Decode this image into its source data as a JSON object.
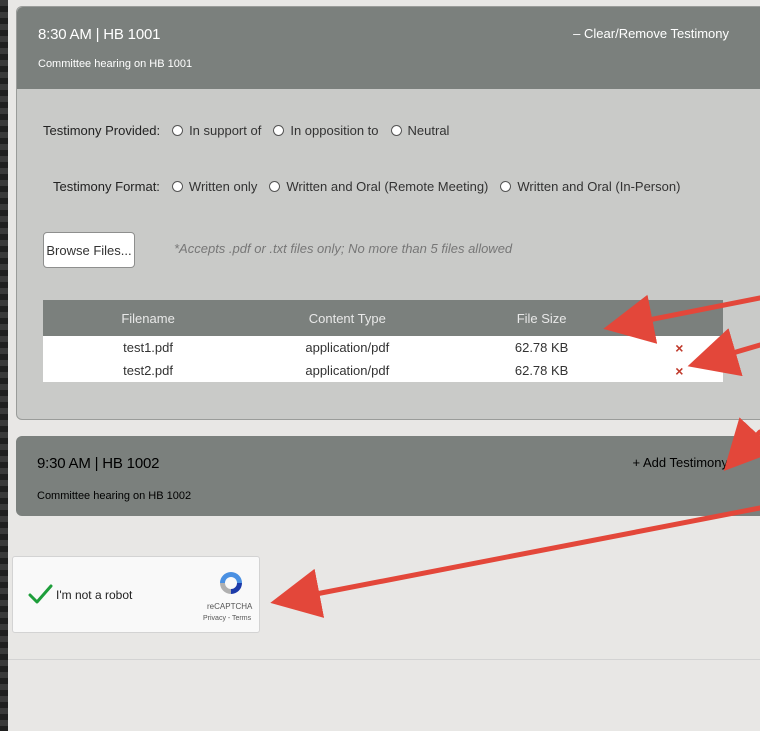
{
  "hearing1": {
    "time_label": "8:30 AM  |  HB 1001",
    "subtitle": "Committee hearing on HB 1001",
    "action": "– Clear/Remove Testimony"
  },
  "testimony_provided": {
    "label": "Testimony Provided:",
    "options": [
      "In support of",
      "In opposition to",
      "Neutral"
    ]
  },
  "testimony_format": {
    "label": "Testimony Format:",
    "options": [
      "Written only",
      "Written and Oral (Remote Meeting)",
      "Written and Oral (In-Person)"
    ]
  },
  "upload": {
    "browse_label": "Browse Files...",
    "hint": "*Accepts .pdf or .txt files only; No more than 5 files allowed"
  },
  "files_table": {
    "headers": [
      "Filename",
      "Content Type",
      "File Size"
    ],
    "rows": [
      {
        "filename": "test1.pdf",
        "content_type": "application/pdf",
        "size": "62.78 KB",
        "remove": "×"
      },
      {
        "filename": "test2.pdf",
        "content_type": "application/pdf",
        "size": "62.78 KB",
        "remove": "×"
      }
    ]
  },
  "hearing2": {
    "time_label": "9:30 AM  |  HB 1002",
    "subtitle": "Committee hearing on HB 1002",
    "action": "+ Add Testimony"
  },
  "captcha": {
    "label": "I'm not a robot",
    "brand": "reCAPTCHA",
    "links": "Privacy - Terms"
  },
  "colors": {
    "header_gray": "#7b807d",
    "panel_gray": "#c9cac8",
    "remove_red": "#c0392b",
    "annotation_arrow": "#e3473a",
    "check_green": "#1e9e3b"
  }
}
